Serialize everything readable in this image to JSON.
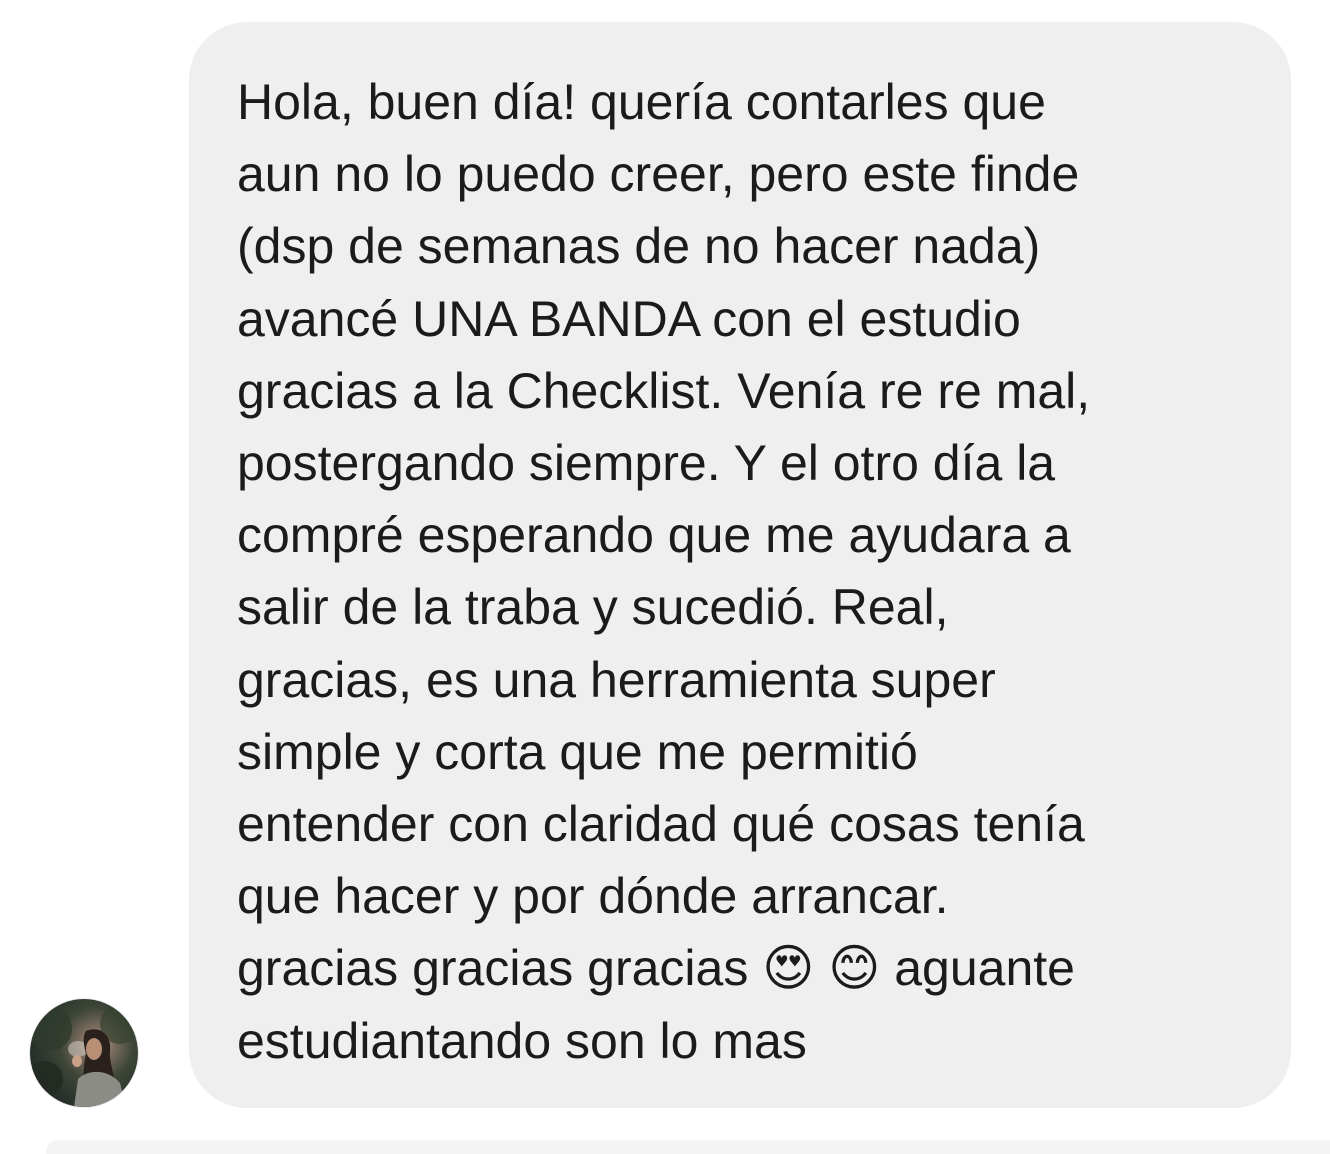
{
  "thread": {
    "message": {
      "text": "Hola, buen día! quería contarles que\naun no lo puedo creer, pero este finde\n(dsp de semanas de no hacer nada)\navancé UNA BANDA con el estudio\ngracias a la Checklist. Venía re re mal,\npostergando siempre. Y el otro día la\ncompré esperando que me ayudara a\nsalir de la traba y sucedió. Real,\ngracias, es una herramienta super\nsimple y corta que me permitió\nentender con claridad qué cosas tenía\nque hacer y por dónde arrancar.\ngracias gracias gracias 😍 😊 aguante\nestudiantando son lo mas"
    },
    "avatar_icon": "user-avatar-photo"
  },
  "colors": {
    "bubble_background": "#efefef",
    "text": "#1b1b1b",
    "page_background": "#ffffff"
  }
}
